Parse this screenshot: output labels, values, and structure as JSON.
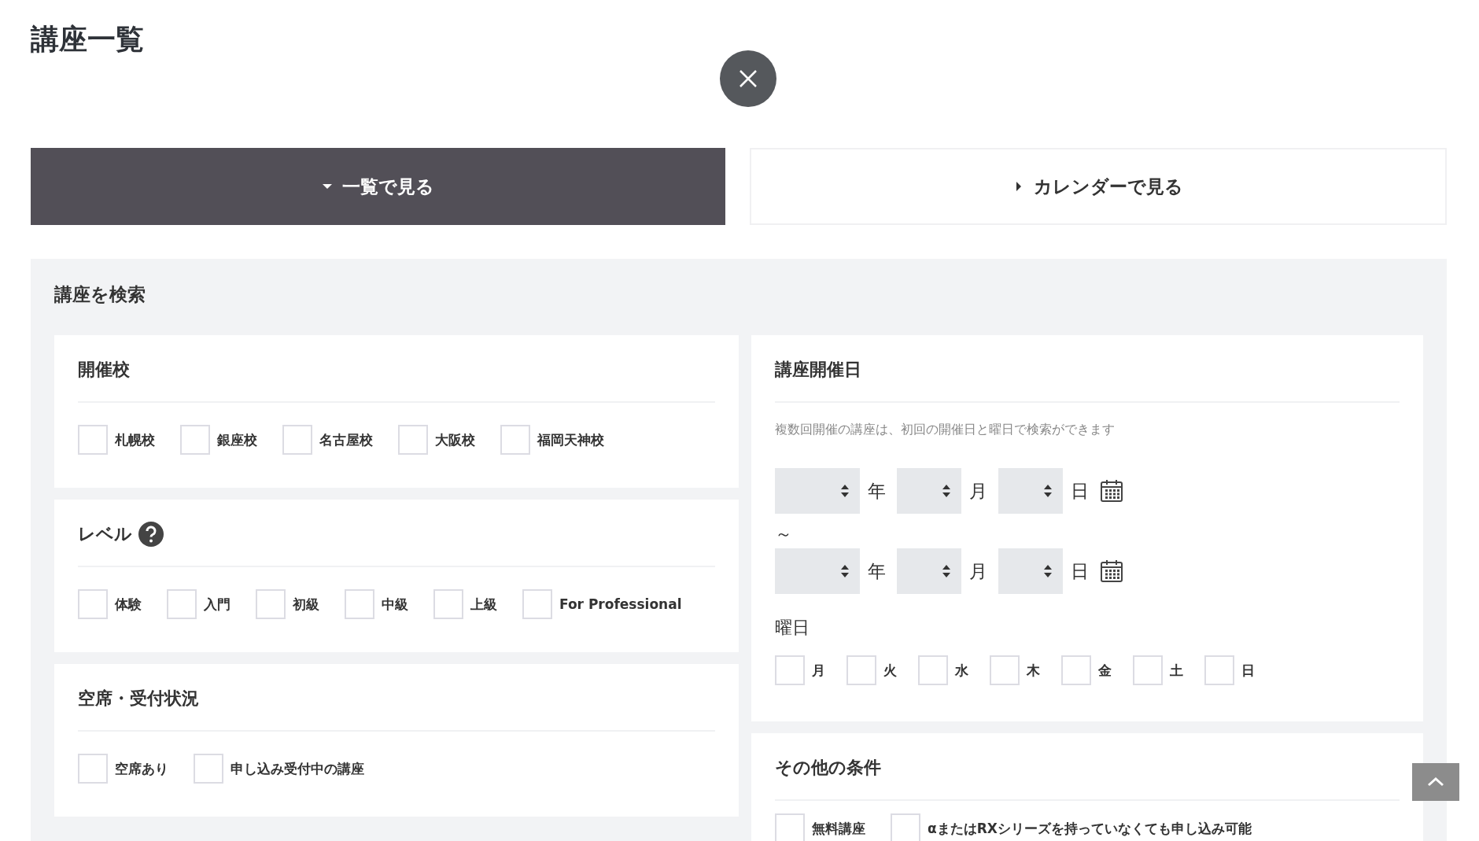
{
  "page_title": "講座一覧",
  "tabs": [
    {
      "label": "一覧で見る",
      "selected": true
    },
    {
      "label": "カレンダーで見る",
      "selected": false
    }
  ],
  "search": {
    "title": "講座を検索",
    "left_cards": [
      {
        "heading": "開催校",
        "help": false,
        "options": [
          {
            "label": "札幌校",
            "checked": false
          },
          {
            "label": "銀座校",
            "checked": false
          },
          {
            "label": "名古屋校",
            "checked": false
          },
          {
            "label": "大阪校",
            "checked": false
          },
          {
            "label": "福岡天神校",
            "checked": false
          }
        ]
      },
      {
        "heading": "レベル",
        "help": true,
        "options": [
          {
            "label": "体験",
            "checked": false
          },
          {
            "label": "入門",
            "checked": false
          },
          {
            "label": "初級",
            "checked": false
          },
          {
            "label": "中級",
            "checked": false
          },
          {
            "label": "上級",
            "checked": false
          },
          {
            "label": "For Professional",
            "checked": false
          }
        ]
      },
      {
        "heading": "空席・受付状況",
        "help": false,
        "options": [
          {
            "label": "空席あり",
            "checked": false
          },
          {
            "label": "申し込み受付中の講座",
            "checked": false
          }
        ]
      }
    ],
    "date_card": {
      "heading": "講座開催日",
      "note": "複数回開催の講座は、初回の開催日と曜日で検索ができます",
      "date_rows": [
        {
          "units": [
            "年",
            "月",
            "日"
          ]
        },
        {
          "units": [
            "年",
            "月",
            "日"
          ]
        }
      ],
      "separator": "～",
      "weekday_label": "曜日",
      "weekdays": [
        {
          "label": "月",
          "checked": false
        },
        {
          "label": "火",
          "checked": false
        },
        {
          "label": "水",
          "checked": false
        },
        {
          "label": "木",
          "checked": false
        },
        {
          "label": "金",
          "checked": false
        },
        {
          "label": "土",
          "checked": false
        },
        {
          "label": "日",
          "checked": false
        }
      ]
    },
    "other_card": {
      "heading": "その他の条件",
      "options": [
        {
          "label": "無料講座",
          "checked": false
        },
        {
          "label": "αまたはRXシリーズを持っていなくても申し込み可能",
          "checked": false
        }
      ]
    }
  }
}
